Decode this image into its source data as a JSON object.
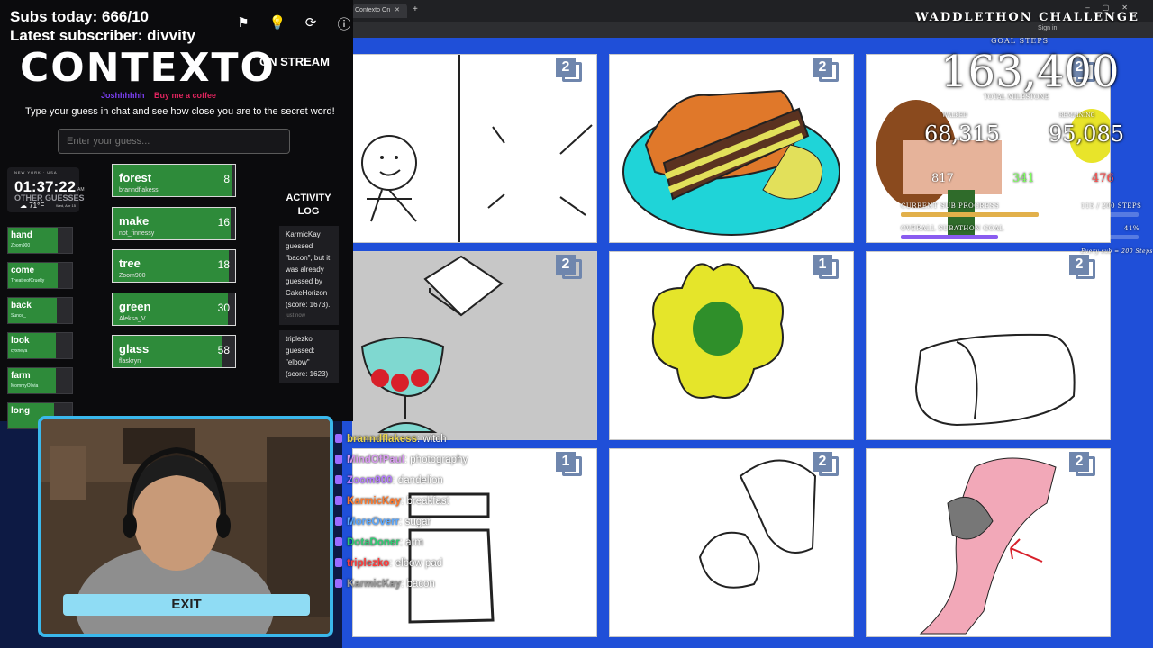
{
  "browser": {
    "tab_label": "Contexto On Stream",
    "signin": "Sign in"
  },
  "overlay": {
    "subs_today": "Subs today: 666/10",
    "latest_sub": "Latest subscriber: divvity"
  },
  "contexto": {
    "logo": "CONTEXTO",
    "on_stream": "ON STREAM",
    "link_twitch": "Joshhhhhh",
    "link_coffee": "Buy me a coffee",
    "instructions": "Type your guess in chat and see how close you are to the secret word!",
    "input_placeholder": "Enter your guess...",
    "top_icons": [
      "flag-icon",
      "lightbulb-icon",
      "refresh-icon",
      "info-icon"
    ]
  },
  "clock": {
    "location": "NEW YORK · USA",
    "time": "01:37:22",
    "ampm": "AM",
    "weather": "71°F",
    "date": "Wed, Apr 15"
  },
  "other_guesses_label": "OTHER GUESSES",
  "other_guesses": [
    {
      "word": "hand",
      "user": "Zoom900",
      "fill": 0.78
    },
    {
      "word": "come",
      "user": "TheatreofCruelty",
      "fill": 0.78
    },
    {
      "word": "back",
      "user": "Sunce_",
      "fill": 0.76
    },
    {
      "word": "look",
      "user": "cyxneya",
      "fill": 0.75
    },
    {
      "word": "farm",
      "user": "MommyOlivia",
      "fill": 0.74
    },
    {
      "word": "long",
      "user": "",
      "fill": 0.72
    }
  ],
  "top_guesses": [
    {
      "word": "forest",
      "user": "brannd­flakess",
      "rank": "8",
      "fill": 0.98
    },
    {
      "word": "make",
      "user": "not_finnessy",
      "rank": "16",
      "fill": 0.96
    },
    {
      "word": "tree",
      "user": "Zoom900",
      "rank": "18",
      "fill": 0.95
    },
    {
      "word": "green",
      "user": "Aleksa_V",
      "rank": "30",
      "fill": 0.94
    },
    {
      "word": "glass",
      "user": "flaskryn",
      "rank": "58",
      "fill": 0.9
    }
  ],
  "activity": {
    "title": "ACTIVITY LOG",
    "entries": [
      {
        "text": "KarmicKay guessed \"bacon\", but it was already guessed by CakeHorizon (score: 1673).",
        "ago": "just now"
      },
      {
        "text": "triplezko guessed: \"elbow\" (score: 1623)",
        "ago": ""
      }
    ]
  },
  "waddlethon": {
    "title": "WADDLETHON CHALLENGE",
    "goal_steps": "GOAL STEPS",
    "total": "163,400",
    "total_label": "TOTAL MILESTONE",
    "walked_label": "WALKED",
    "walked": "68,315",
    "remaining_label": "REMAINING",
    "remaining": "95,085",
    "stat_a": "817",
    "stat_b": "341",
    "stat_c": "476",
    "sub_progress_label": "CURRENT SUB PROGRESS",
    "sub_progress_value": "115 / 200 STEPS",
    "sub_progress": 0.58,
    "overall_label": "OVERALL SUBATHON GOAL",
    "overall_value": "41%",
    "overall": 0.41,
    "every": "Every sub = 200 Steps"
  },
  "tiles": [
    {
      "badge": "2"
    },
    {
      "badge": "2"
    },
    {
      "badge": "2"
    },
    {
      "badge": "2"
    },
    {
      "badge": "1"
    },
    {
      "badge": "2"
    },
    {
      "badge": "1"
    },
    {
      "badge": "2"
    },
    {
      "badge": "2"
    }
  ],
  "chat": [
    {
      "name": "branndflakess",
      "msg": "witch",
      "color": "#e8d44d"
    },
    {
      "name": "MindOfPaul",
      "msg": "photography",
      "color": "#d99cf0"
    },
    {
      "name": "Zoom900",
      "msg": "dandelion",
      "color": "#b57bff"
    },
    {
      "name": "KarmicKay",
      "msg": "breakfast",
      "color": "#ff7a2e"
    },
    {
      "name": "MoreOverr",
      "msg": "sugar",
      "color": "#5ba8ff"
    },
    {
      "name": "DotaDoner",
      "msg": "arm",
      "color": "#2ecc71"
    },
    {
      "name": "triplezko",
      "msg": "elbow pad",
      "color": "#ff3b3b"
    },
    {
      "name": "KarmicKay",
      "msg": "bacon",
      "color": "#9a9a9a"
    }
  ],
  "webcam": {
    "exit_label": "EXIT"
  },
  "colors": {
    "accent_green": "#2e8b3a",
    "cam_border": "#3ab8ec",
    "bg_blue": "#1f4fd8"
  }
}
